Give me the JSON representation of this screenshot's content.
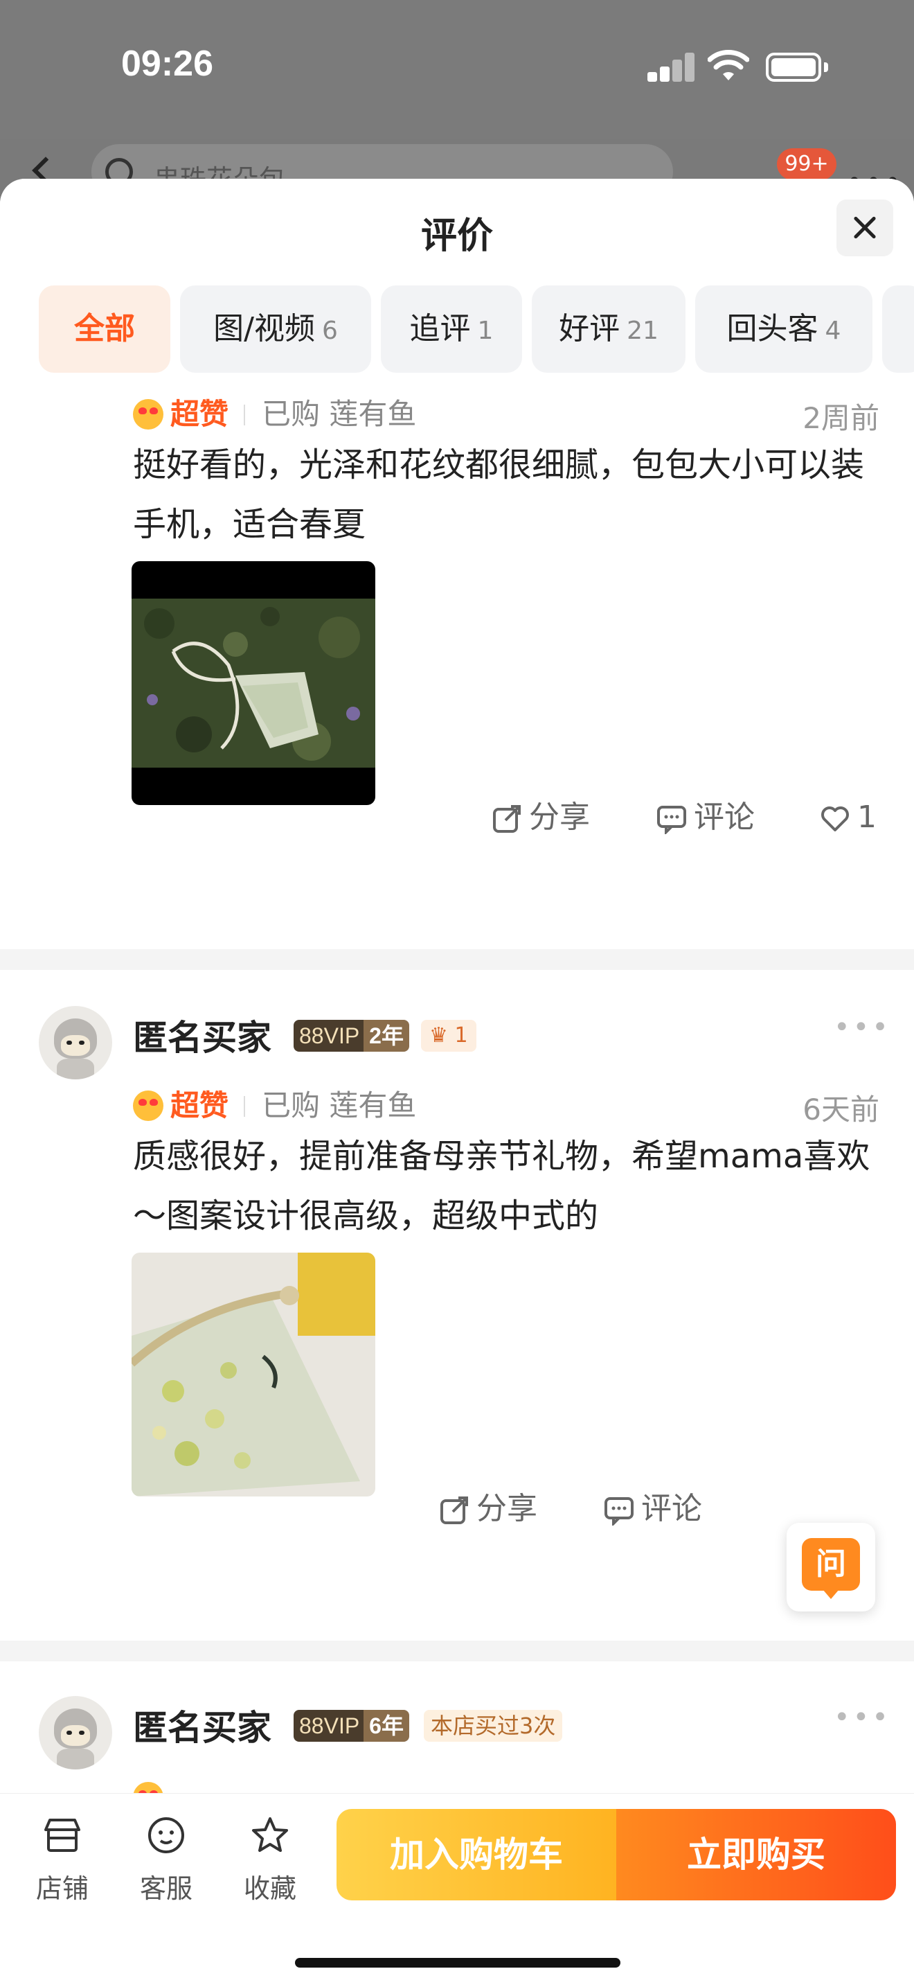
{
  "status": {
    "time": "09:26"
  },
  "underlay": {
    "search_placeholder": "串珠花朵包",
    "cart_badge": "99+"
  },
  "sheet": {
    "title": "评价"
  },
  "tabs": [
    {
      "label": "全部",
      "count": ""
    },
    {
      "label": "图/视频",
      "count": "6"
    },
    {
      "label": "追评",
      "count": "1"
    },
    {
      "label": "好评",
      "count": "21"
    },
    {
      "label": "回头客",
      "count": "4"
    }
  ],
  "reviews": [
    {
      "rating": "超赞",
      "bought": "已购 莲有鱼",
      "time": "2周前",
      "content": "挺好看的，光泽和花纹都很细腻，包包大小可以装手机，适合春夏",
      "share": "分享",
      "comment": "评论",
      "likes": "1"
    },
    {
      "username": "匿名买家",
      "vip_label": "88VIP",
      "vip_years": "2年",
      "crown_count": "1",
      "rating": "超赞",
      "bought": "已购 莲有鱼",
      "time": "6天前",
      "content": "质感很好，提前准备母亲节礼物，希望mama喜欢～图案设计很高级，超级中式的",
      "share": "分享",
      "comment": "评论"
    },
    {
      "username": "匿名买家",
      "vip_label": "88VIP",
      "vip_years": "6年",
      "shop_tag": "本店买过3次"
    }
  ],
  "ask_button": "问",
  "bottombar": {
    "shop": "店铺",
    "service": "客服",
    "favorite": "收藏",
    "add_to_cart": "加入购物车",
    "buy_now": "立即购买"
  }
}
